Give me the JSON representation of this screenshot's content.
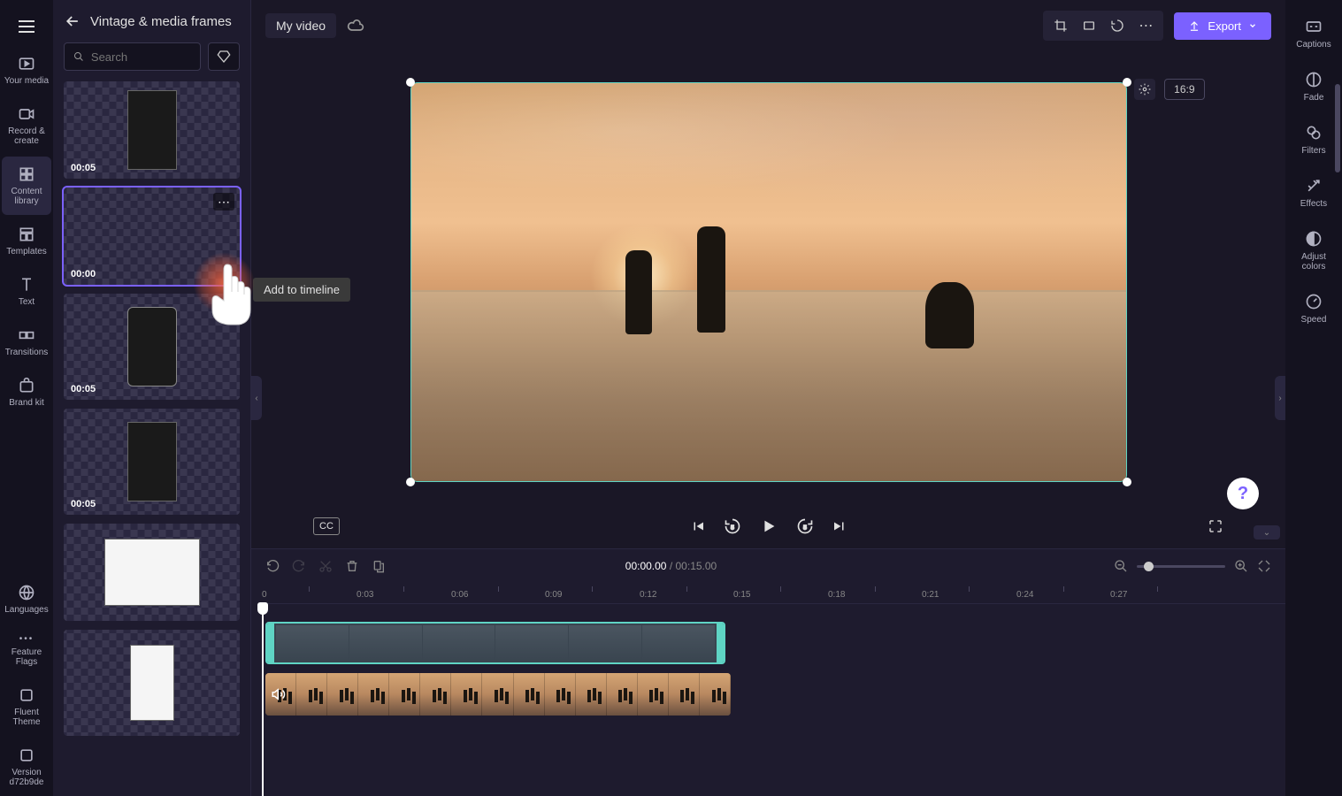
{
  "leftNav": {
    "items": [
      {
        "label": "Your media"
      },
      {
        "label": "Record & create"
      },
      {
        "label": "Content library"
      },
      {
        "label": "Templates"
      },
      {
        "label": "Text"
      },
      {
        "label": "Transitions"
      },
      {
        "label": "Brand kit"
      }
    ],
    "bottomItems": [
      {
        "label": "Languages"
      },
      {
        "label": "Feature Flags"
      },
      {
        "label": "Fluent Theme"
      },
      {
        "label": "Version d72b9de"
      }
    ]
  },
  "panel": {
    "title": "Vintage & media frames",
    "searchPlaceholder": "Search"
  },
  "thumbs": [
    {
      "time": "00:05"
    },
    {
      "time": "00:00"
    },
    {
      "time": "00:05"
    },
    {
      "time": "00:05"
    },
    {
      "time": ""
    },
    {
      "time": ""
    }
  ],
  "tooltip": "Add to timeline",
  "topBar": {
    "title": "My video",
    "export": "Export",
    "aspectRatio": "16:9"
  },
  "playback": {
    "cc": "CC",
    "currentTime": "00:00.00",
    "totalTime": "00:15.00"
  },
  "ruler": [
    "0",
    "0:03",
    "0:06",
    "0:09",
    "0:12",
    "0:15",
    "0:18",
    "0:21",
    "0:24",
    "0:27"
  ],
  "rightPanel": {
    "items": [
      {
        "label": "Captions"
      },
      {
        "label": "Fade"
      },
      {
        "label": "Filters"
      },
      {
        "label": "Effects"
      },
      {
        "label": "Adjust colors"
      },
      {
        "label": "Speed"
      }
    ]
  }
}
